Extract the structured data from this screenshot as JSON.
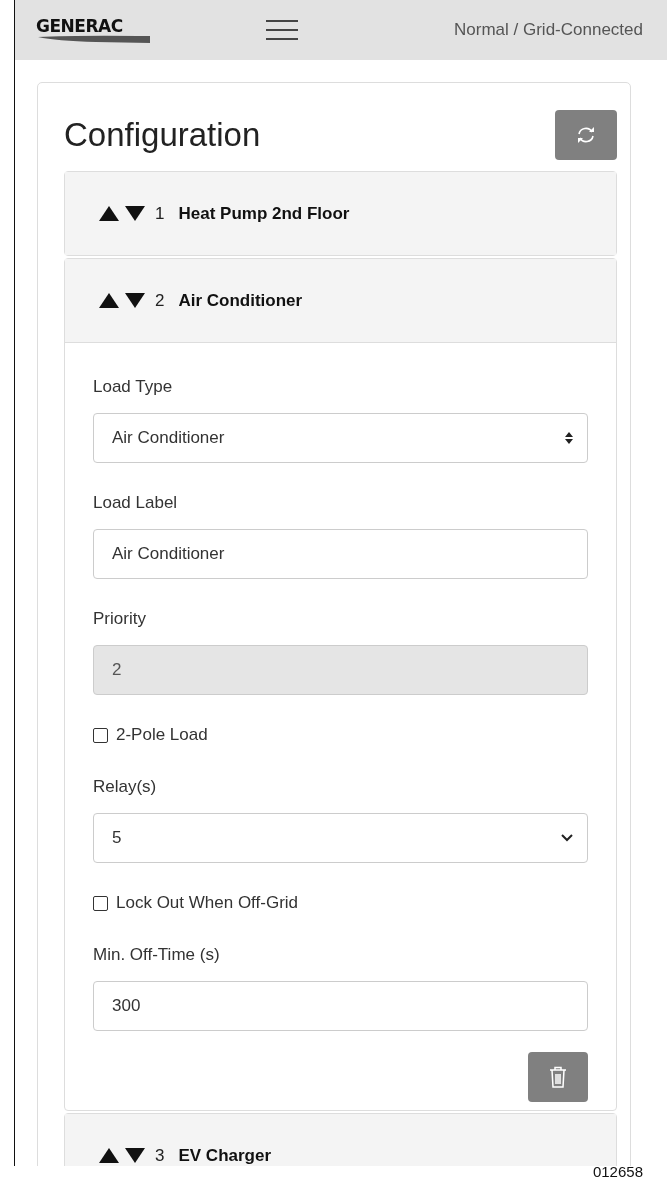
{
  "header": {
    "logo": "GENERAC",
    "status": "Normal / Grid-Connected"
  },
  "panel": {
    "title": "Configuration",
    "loads": [
      {
        "number": "1",
        "name": "Heat Pump 2nd Floor",
        "expanded": false
      },
      {
        "number": "2",
        "name": "Air Conditioner",
        "expanded": true,
        "fields": [
          {
            "kind": "spinner-select",
            "label": "Load Type",
            "value": "Air Conditioner"
          },
          {
            "kind": "text",
            "label": "Load Label",
            "value": "Air Conditioner",
            "disabled": false
          },
          {
            "kind": "text",
            "label": "Priority",
            "value": "2",
            "disabled": true
          },
          {
            "kind": "checkbox",
            "label": "2-Pole Load",
            "checked": false
          },
          {
            "kind": "dropdown",
            "label": "Relay(s)",
            "value": "5"
          },
          {
            "kind": "checkbox",
            "label": "Lock Out When Off-Grid",
            "checked": false
          },
          {
            "kind": "text",
            "label": "Min. Off-Time (s)",
            "value": "300",
            "disabled": false
          }
        ]
      },
      {
        "number": "3",
        "name": "EV Charger",
        "expanded": false
      }
    ]
  },
  "figure_number": "012658"
}
